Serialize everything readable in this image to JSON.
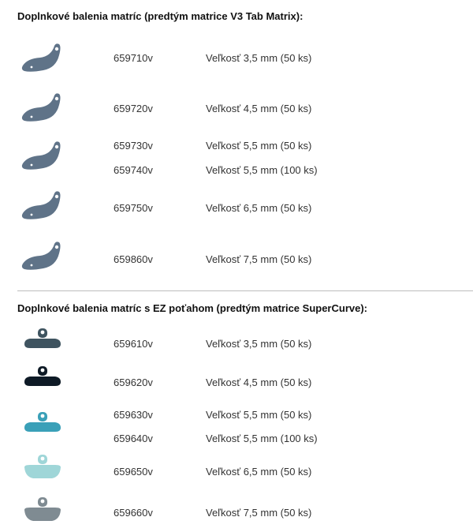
{
  "sections": [
    {
      "title": "Doplnkové balenia matríc (predtým matrice V3 Tab Matrix):",
      "groups": [
        {
          "icon": "curved-matrix-band-icon",
          "color": "#5f7388",
          "items": [
            {
              "code": "659710v",
              "desc": "Veľkosť 3,5 mm (50 ks)"
            }
          ]
        },
        {
          "icon": "curved-matrix-band-icon",
          "color": "#5f7388",
          "items": [
            {
              "code": "659720v",
              "desc": "Veľkosť 4,5 mm (50 ks)"
            }
          ]
        },
        {
          "icon": "curved-matrix-band-icon",
          "color": "#5f7388",
          "items": [
            {
              "code": "659730v",
              "desc": "Veľkosť 5,5 mm (50 ks)"
            },
            {
              "code": "659740v",
              "desc": "Veľkosť 5,5 mm (100 ks)"
            }
          ]
        },
        {
          "icon": "curved-matrix-band-icon",
          "color": "#5f7388",
          "items": [
            {
              "code": "659750v",
              "desc": "Veľkosť 6,5 mm (50 ks)"
            }
          ]
        },
        {
          "icon": "curved-matrix-band-icon",
          "color": "#5f7388",
          "items": [
            {
              "code": "659860v",
              "desc": "Veľkosť 7,5 mm (50 ks)"
            }
          ]
        }
      ]
    },
    {
      "title": "Doplnkové balenia matríc s EZ poťahom (predtým matrice SuperCurve):",
      "groups": [
        {
          "icon": "ez-coated-matrix-icon",
          "color": "#3f5460",
          "items": [
            {
              "code": "659610v",
              "desc": "Veľkosť 3,5 mm (50 ks)"
            }
          ]
        },
        {
          "icon": "ez-coated-matrix-icon",
          "color": "#0e1a26",
          "items": [
            {
              "code": "659620v",
              "desc": "Veľkosť 4,5 mm (50 ks)"
            }
          ]
        },
        {
          "icon": "ez-coated-matrix-icon",
          "color": "#3aa0b8",
          "items": [
            {
              "code": "659630v",
              "desc": "Veľkosť 5,5 mm (50 ks)"
            },
            {
              "code": "659640v",
              "desc": "Veľkosť 5,5 mm (100 ks)"
            }
          ]
        },
        {
          "icon": "ez-coated-matrix-icon",
          "color": "#9fd6d8",
          "items": [
            {
              "code": "659650v",
              "desc": "Veľkosť 6,5 mm (50 ks)"
            }
          ]
        },
        {
          "icon": "ez-coated-matrix-icon",
          "color": "#7f8b92",
          "items": [
            {
              "code": "659660v",
              "desc": "Veľkosť 7,5 mm (50 ks)"
            }
          ]
        }
      ]
    }
  ]
}
